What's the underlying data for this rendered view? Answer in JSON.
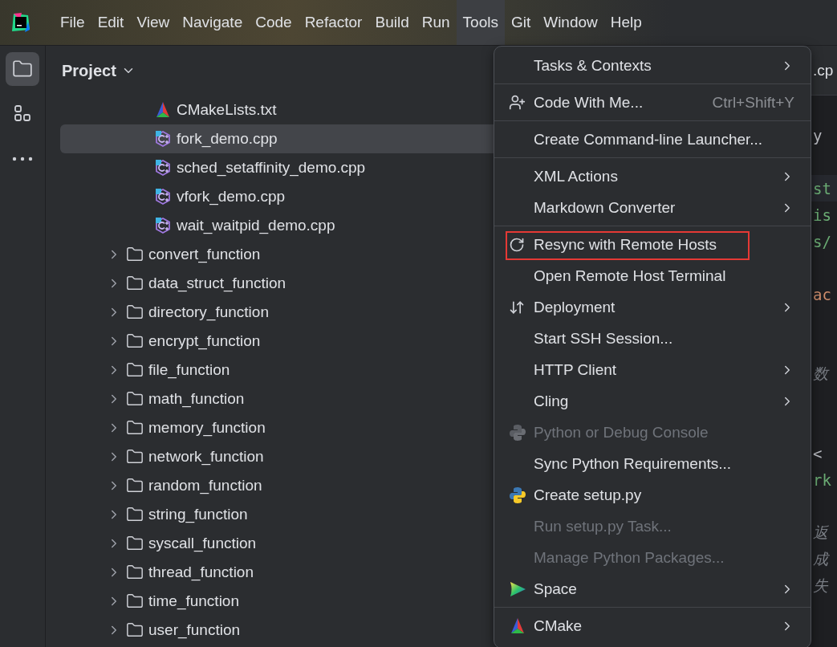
{
  "menubar": {
    "items": [
      {
        "label": "File",
        "selected": false
      },
      {
        "label": "Edit",
        "selected": false
      },
      {
        "label": "View",
        "selected": false
      },
      {
        "label": "Navigate",
        "selected": false
      },
      {
        "label": "Code",
        "selected": false
      },
      {
        "label": "Refactor",
        "selected": false
      },
      {
        "label": "Build",
        "selected": false
      },
      {
        "label": "Run",
        "selected": false
      },
      {
        "label": "Tools",
        "selected": true
      },
      {
        "label": "Git",
        "selected": false
      },
      {
        "label": "Window",
        "selected": false
      },
      {
        "label": "Help",
        "selected": false
      }
    ]
  },
  "toolstrip": [
    {
      "kind": "folder",
      "selected": true
    },
    {
      "kind": "structure",
      "selected": false
    },
    {
      "kind": "more",
      "selected": false
    }
  ],
  "project": {
    "title": "Project",
    "files": [
      {
        "label": "CMakeLists.txt",
        "kind": "cmake",
        "selected": false
      },
      {
        "label": "fork_demo.cpp",
        "kind": "cpp",
        "selected": true
      },
      {
        "label": "sched_setaffinity_demo.cpp",
        "kind": "cpp",
        "selected": false
      },
      {
        "label": "vfork_demo.cpp",
        "kind": "cpp",
        "selected": false
      },
      {
        "label": "wait_waitpid_demo.cpp",
        "kind": "cpp",
        "selected": false
      }
    ],
    "folders": [
      {
        "label": "convert_function",
        "expanded": false
      },
      {
        "label": "data_struct_function",
        "expanded": false
      },
      {
        "label": "directory_function",
        "expanded": false
      },
      {
        "label": "encrypt_function",
        "expanded": false
      },
      {
        "label": "file_function",
        "expanded": false
      },
      {
        "label": "math_function",
        "expanded": false
      },
      {
        "label": "memory_function",
        "expanded": false
      },
      {
        "label": "network_function",
        "expanded": false
      },
      {
        "label": "random_function",
        "expanded": false
      },
      {
        "label": "string_function",
        "expanded": false
      },
      {
        "label": "syscall_function",
        "expanded": false
      },
      {
        "label": "thread_function",
        "expanded": false
      },
      {
        "label": "time_function",
        "expanded": false
      },
      {
        "label": "user_function",
        "expanded": false
      }
    ]
  },
  "editor": {
    "tab": ".cp",
    "lines": [
      {
        "kind": "blank"
      },
      {
        "kind": "plain",
        "text": "y"
      },
      {
        "kind": "blank"
      },
      {
        "kind": "string",
        "text": "st",
        "current": true
      },
      {
        "kind": "string",
        "text": "is"
      },
      {
        "kind": "string",
        "text": "s/"
      },
      {
        "kind": "blank"
      },
      {
        "kind": "keyword",
        "text": "ac"
      },
      {
        "kind": "blank"
      },
      {
        "kind": "blank"
      },
      {
        "kind": "comment",
        "text": "数"
      },
      {
        "kind": "blank"
      },
      {
        "kind": "blank"
      },
      {
        "kind": "plain",
        "text": "<"
      },
      {
        "kind": "string",
        "text": "rk"
      },
      {
        "kind": "blank"
      },
      {
        "kind": "comment",
        "text": "返"
      },
      {
        "kind": "comment",
        "text": "成"
      },
      {
        "kind": "comment",
        "text": "失"
      },
      {
        "kind": "blank"
      }
    ]
  },
  "menu": {
    "groups": [
      [
        {
          "kind": "plain",
          "label": "Tasks & Contexts",
          "submenu": true,
          "disabled": false,
          "outlined": false
        }
      ],
      [
        {
          "kind": "person",
          "label": "Code With Me...",
          "shortcut": "Ctrl+Shift+Y",
          "submenu": false,
          "disabled": false,
          "outlined": false
        }
      ],
      [
        {
          "kind": "plain",
          "label": "Create Command-line Launcher...",
          "submenu": false,
          "disabled": false,
          "outlined": false
        }
      ],
      [
        {
          "kind": "plain",
          "label": "XML Actions",
          "submenu": true,
          "disabled": false,
          "outlined": false
        },
        {
          "kind": "plain",
          "label": "Markdown Converter",
          "submenu": true,
          "disabled": false,
          "outlined": false
        }
      ],
      [
        {
          "kind": "refresh",
          "label": "Resync with Remote Hosts",
          "submenu": false,
          "disabled": false,
          "outlined": true
        },
        {
          "kind": "plain",
          "label": "Open Remote Host Terminal",
          "submenu": false,
          "disabled": false,
          "outlined": false
        },
        {
          "kind": "arrows",
          "label": "Deployment",
          "submenu": true,
          "disabled": false,
          "outlined": false
        },
        {
          "kind": "plain",
          "label": "Start SSH Session...",
          "submenu": false,
          "disabled": false,
          "outlined": false
        },
        {
          "kind": "plain",
          "label": "HTTP Client",
          "submenu": true,
          "disabled": false,
          "outlined": false
        },
        {
          "kind": "plain",
          "label": "Cling",
          "submenu": true,
          "disabled": false,
          "outlined": false
        },
        {
          "kind": "python",
          "label": "Python or Debug Console",
          "submenu": false,
          "disabled": true,
          "outlined": false
        },
        {
          "kind": "plain",
          "label": "Sync Python Requirements...",
          "submenu": false,
          "disabled": false,
          "outlined": false
        },
        {
          "kind": "python",
          "label": "Create setup.py",
          "submenu": false,
          "disabled": false,
          "outlined": false
        },
        {
          "kind": "plain",
          "label": "Run setup.py Task...",
          "submenu": false,
          "disabled": true,
          "outlined": false
        },
        {
          "kind": "plain",
          "label": "Manage Python Packages...",
          "submenu": false,
          "disabled": true,
          "outlined": false
        },
        {
          "kind": "space",
          "label": "Space",
          "submenu": true,
          "disabled": false,
          "outlined": false
        }
      ],
      [
        {
          "kind": "cmake",
          "label": "CMake",
          "submenu": true,
          "disabled": false,
          "outlined": false
        }
      ]
    ]
  }
}
